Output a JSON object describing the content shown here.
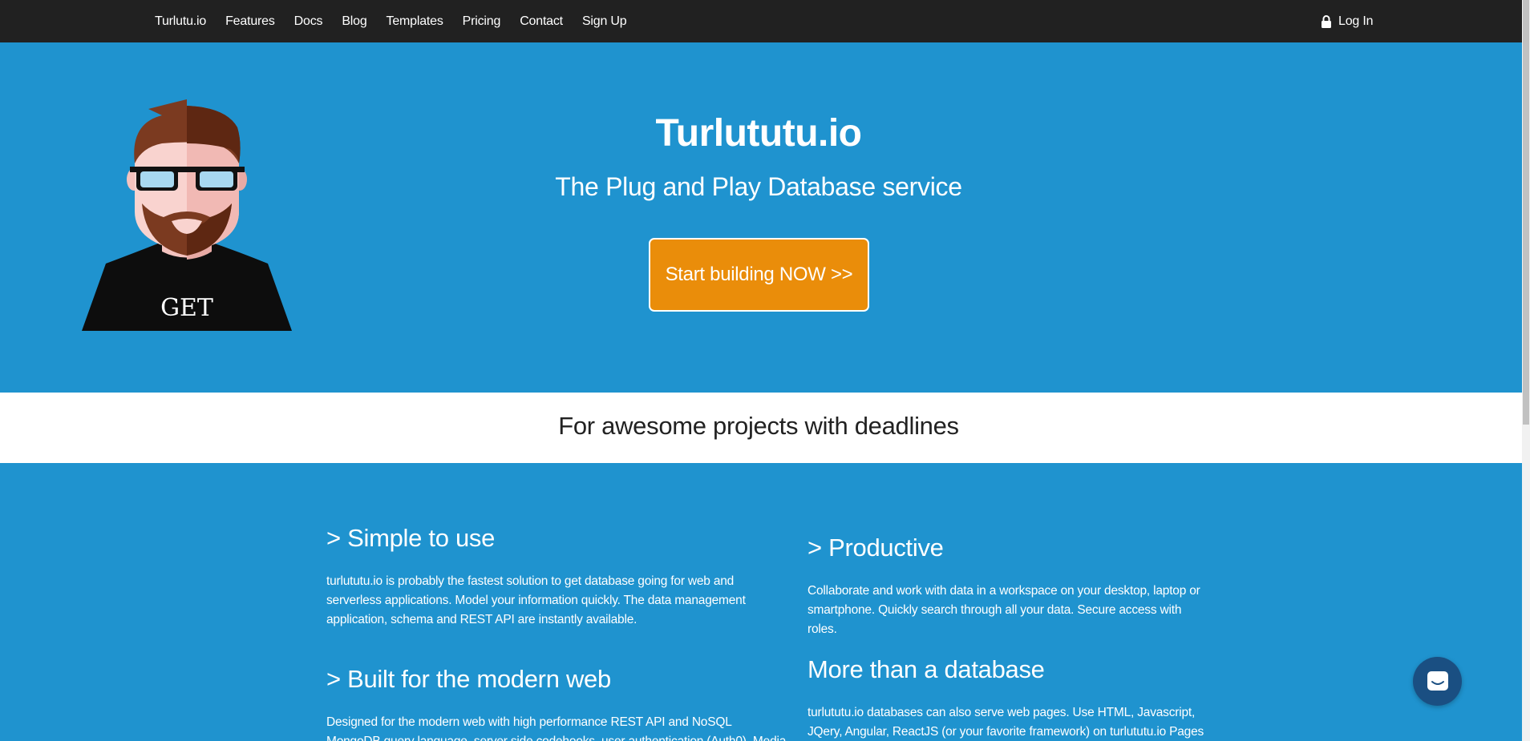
{
  "nav": {
    "links": [
      "Turlutu.io",
      "Features",
      "Docs",
      "Blog",
      "Templates",
      "Pricing",
      "Contact",
      "Sign Up"
    ],
    "login_label": "Log In",
    "login_icon": "lock-icon"
  },
  "hero": {
    "title": "Turlututu.io",
    "subtitle": "The Plug and Play Database service",
    "cta_label": "Start building NOW >>",
    "avatar_shirt_text": "GET"
  },
  "band": {
    "text": "For awesome projects with deadlines"
  },
  "features": {
    "simple": {
      "heading": "> Simple to use",
      "text": "turlututu.io is probably the fastest solution to get database going for web and serverless applications. Model your information quickly. The data management application, schema and REST API are instantly available."
    },
    "productive": {
      "heading": "> Productive",
      "text": "Collaborate and work with data in a workspace on your desktop, laptop or smartphone. Quickly search through all your data. Secure access with roles."
    },
    "modern": {
      "heading": "> Built for the modern web",
      "text": "Designed for the modern web with high performance REST API and NoSQL MongoDB query language, server side codehooks, user authentication (Auth0), Media Archive, Realtime"
    },
    "more": {
      "heading": "More than a database",
      "text": "turlututu.io databases can also serve web pages. Use HTML, Javascript, JQery, Angular, ReactJS (or your favorite framework) on turlututu.io Pages"
    }
  },
  "colors": {
    "primary_blue": "#1f93cf",
    "navbar": "#212121",
    "cta_orange": "#ea8d0a",
    "chat_button": "#1a4f82"
  },
  "chat": {
    "icon": "chat-icon"
  }
}
